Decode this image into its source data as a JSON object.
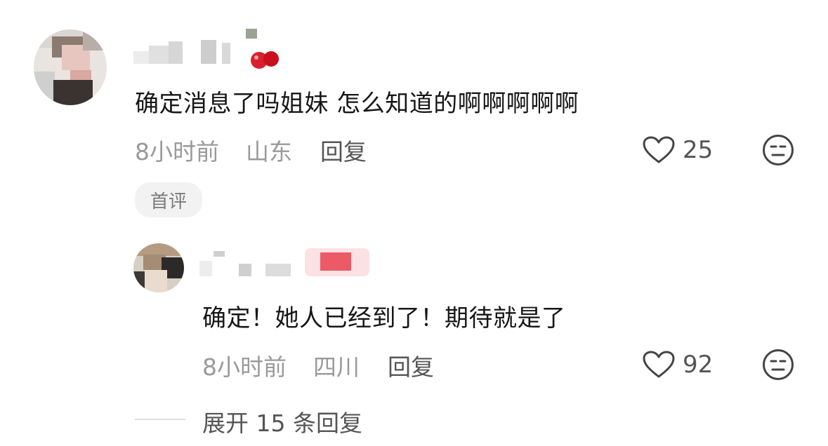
{
  "comments": [
    {
      "text": "确定消息了吗姐妹 怎么知道的啊啊啊啊啊",
      "time": "8小时前",
      "location": "山东",
      "reply_label": "回复",
      "likes": "25",
      "tag": "首评"
    },
    {
      "text": "确定！她人已经到了！期待就是了",
      "time": "8小时前",
      "location": "四川",
      "reply_label": "回复",
      "likes": "92"
    }
  ],
  "expand_label": "展开 15 条回复",
  "colors": {
    "meta": "#9a9a9a",
    "badge_red": "#d8202e",
    "pill_bg": "#f2f2f2"
  }
}
